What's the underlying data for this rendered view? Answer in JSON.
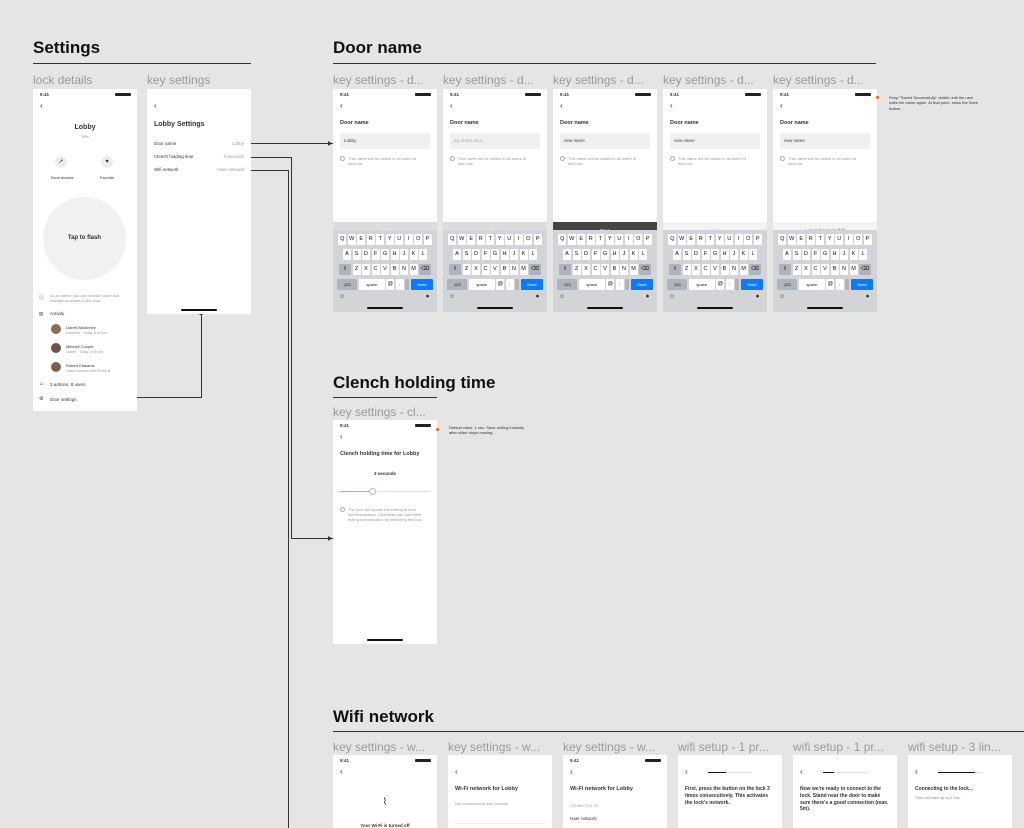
{
  "sections": {
    "settings": "Settings",
    "door_name": "Door name",
    "clench": "Clench holding time",
    "wifi": "Wifi network"
  },
  "frame_labels": {
    "lock_details": "lock details",
    "key_settings": "key settings",
    "door_name": [
      "key settings - d...",
      "key settings - d...",
      "key settings - d...",
      "key settings - d...",
      "key settings - d..."
    ],
    "clench": "key settings - cl...",
    "wifi": [
      "key settings - w...",
      "key settings - w...",
      "key settings - w...",
      "wifi setup - 1 pr...",
      "wifi setup - 1 pr...",
      "wifi setup - 3 lin..."
    ]
  },
  "status_time": "9:41",
  "lock_details": {
    "title": "Lobby",
    "battery": "76%",
    "send_access": "Send access",
    "favorite": "Favorite",
    "tap_to_flash": "Tap to flash",
    "admin_note": "As an admin, you can monitor, share and manage accesses to this door.",
    "activity": "Activity",
    "activity_items": [
      {
        "name": "Darrell Mckinney",
        "detail": "unlocked · Today, 8:52 pm"
      },
      {
        "name": "Mitchell Cooper",
        "detail": "locked · Today, 8:40 pm"
      },
      {
        "name": "Robert Edwards",
        "detail": "shared access with Emma B"
      }
    ],
    "admins": "3 admins, 8 users",
    "door_settings": "Door settings"
  },
  "key_settings": {
    "title": "Lobby Settings",
    "rows": [
      {
        "label": "Door name",
        "value": "Lobby"
      },
      {
        "label": "Clench holding time",
        "value": "3 seconds"
      },
      {
        "label": "Wifi network",
        "value": "Haer network"
      }
    ]
  },
  "door_name": {
    "title": "Door name",
    "inputs": [
      "Lobby",
      "eg. Entry door...",
      "new name",
      "new name",
      "new name"
    ],
    "hint": "This name will be visible to all users of this lock.",
    "save": "Save",
    "saving": "• • •",
    "saved": "Saved successfully",
    "note": "Keep \"Saved Successfully\" visible until the user edits the name again. At that point, show the Save button.",
    "keyboard": {
      "row1": [
        "Q",
        "W",
        "E",
        "R",
        "T",
        "Y",
        "U",
        "I",
        "O",
        "P"
      ],
      "row2": [
        "A",
        "S",
        "D",
        "F",
        "G",
        "H",
        "J",
        "K",
        "L"
      ],
      "row3": [
        "Z",
        "X",
        "C",
        "V",
        "B",
        "N",
        "M"
      ],
      "num": "123",
      "space": "space",
      "at": "@",
      "dot": ".",
      "send": "Send"
    }
  },
  "clench": {
    "title": "Clench holding time for Lobby",
    "value": "3 seconds",
    "hint": "The lock will update the setting at next synchronisation. Otherwise you can force that synchronisation by rebooting the lock.",
    "note": "Default value: 1 sec. Save setting instantly after slider stops moving.",
    "slider_fraction": 0.35
  },
  "wifi": {
    "s1_text": "Your Wi-Fi is turned off",
    "s2_title": "Wi-Fi network for Lobby",
    "s2_sub": "Not connected to any network",
    "s3_title": "Wi-Fi network for Lobby",
    "s3_sub": "CONNECTED TO",
    "s3_net": "Haer network",
    "s4_text": "First, press the button on the lock 3 times consecutively. This activates the lock's network.",
    "s5_text": "Now we're ready to connect to the lock. Stand near the door to make sure there's a good connection (max. 5m).",
    "s6_title": "Connecting to the lock...",
    "s6_sub": "This can take up to 2 min."
  },
  "colors": {
    "accent": "#0a7aff",
    "dark_save": "#444444",
    "note_dot": "#f25c05"
  }
}
